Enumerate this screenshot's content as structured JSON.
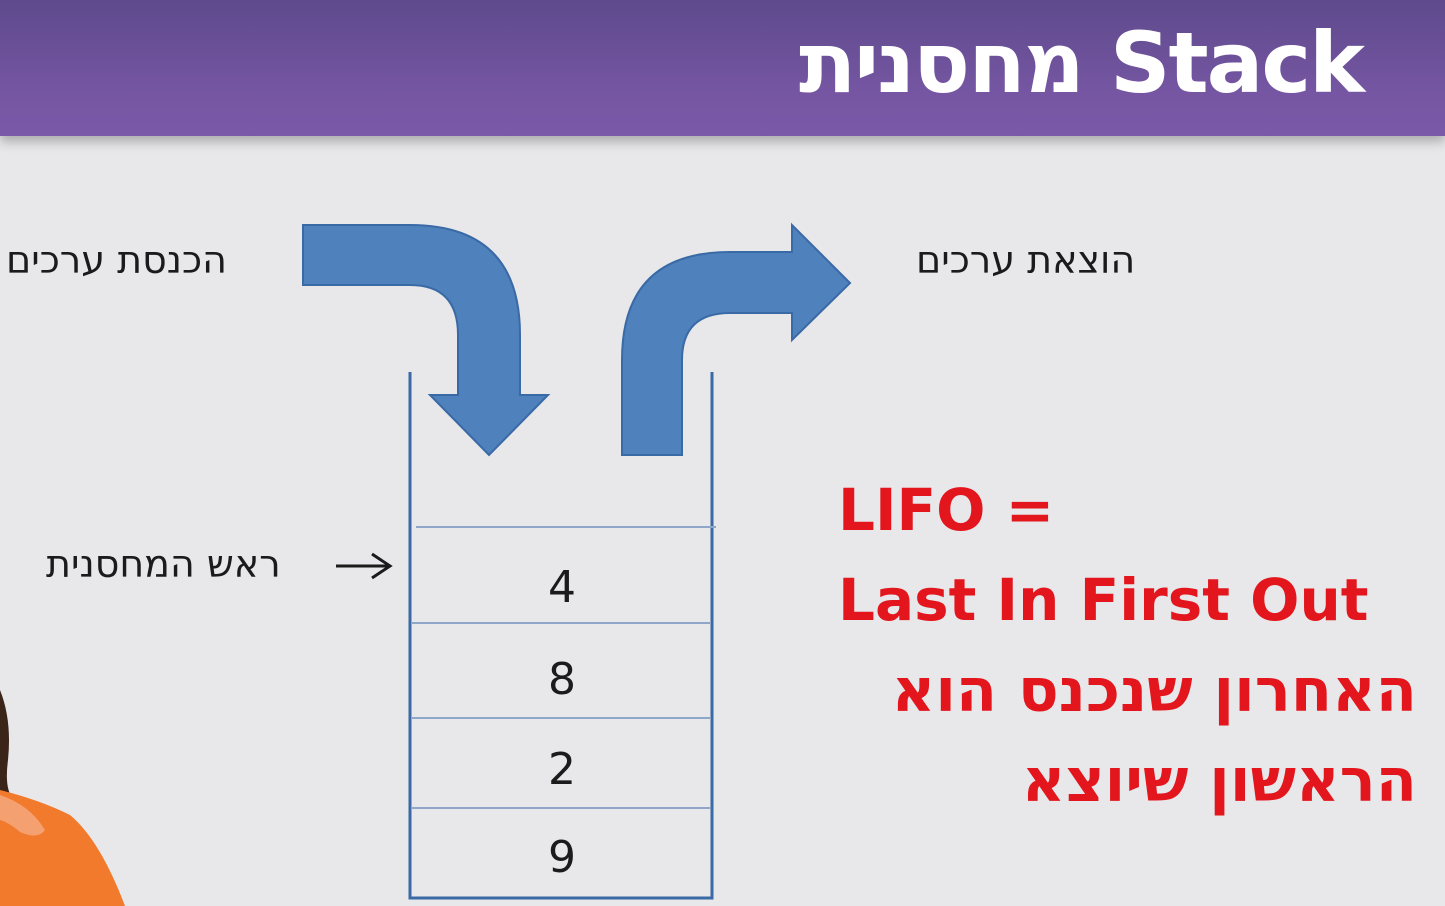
{
  "slide": {
    "title": "מחסנית Stack"
  },
  "labels": {
    "push": "הכנסת ערכים",
    "pop": "הוצאת ערכים",
    "top_of_stack": "ראש המחסנית"
  },
  "stack": {
    "values": [
      "4",
      "8",
      "2",
      "9"
    ]
  },
  "lifo": {
    "line1": "LIFO =",
    "line2": "Last In First Out",
    "line3": "האחרון שנכנס הוא",
    "line4": "הראשון שיוצא"
  },
  "colors": {
    "header": "#7656a3",
    "arrow": "#4f81bd",
    "lifo_text": "#e2161c",
    "background": "#e8e7ea"
  }
}
